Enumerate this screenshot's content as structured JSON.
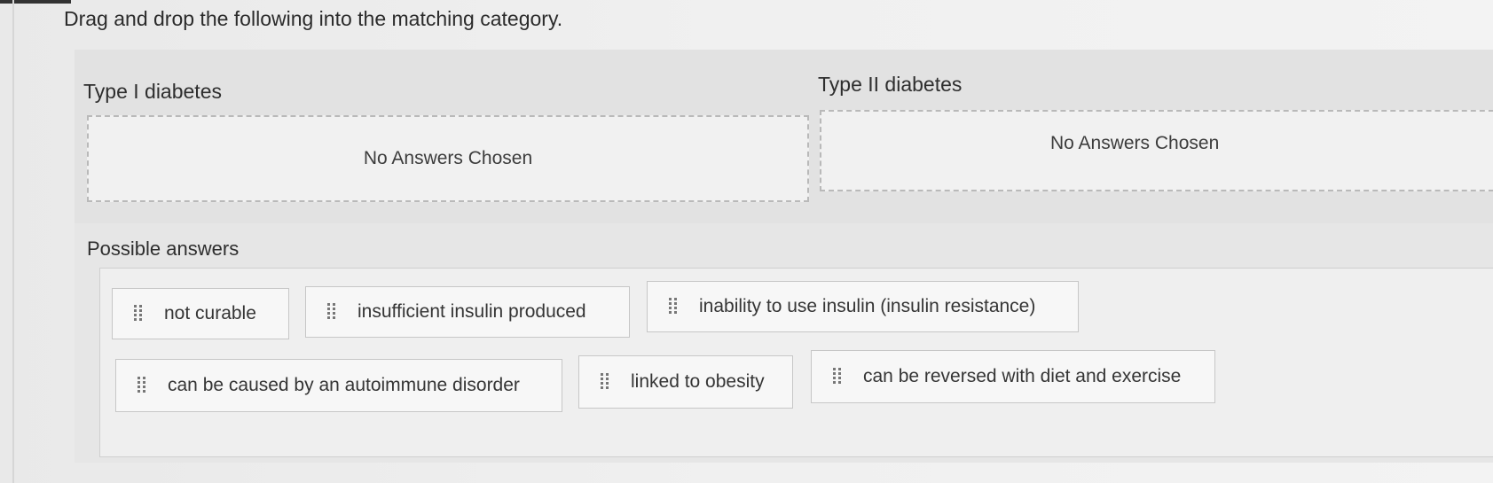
{
  "instruction": "Drag and drop the following into the matching category.",
  "categories": [
    {
      "title": "Type I diabetes",
      "empty_text": "No Answers Chosen"
    },
    {
      "title": "Type II diabetes",
      "empty_text": "No Answers Chosen"
    }
  ],
  "answers": {
    "title": "Possible answers",
    "items": [
      {
        "label": "not curable",
        "handle_icon": "drag-handle-icon"
      },
      {
        "label": "insufficient insulin produced",
        "handle_icon": "drag-handle-icon"
      },
      {
        "label": "inability to use insulin (insulin resistance)",
        "handle_icon": "drag-handle-icon"
      },
      {
        "label": "can be caused by an autoimmune disorder",
        "handle_icon": "drag-handle-icon"
      },
      {
        "label": "linked to obesity",
        "handle_icon": "drag-handle-icon"
      },
      {
        "label": "can be reversed with diet and exercise",
        "handle_icon": "drag-handle-icon"
      }
    ]
  }
}
